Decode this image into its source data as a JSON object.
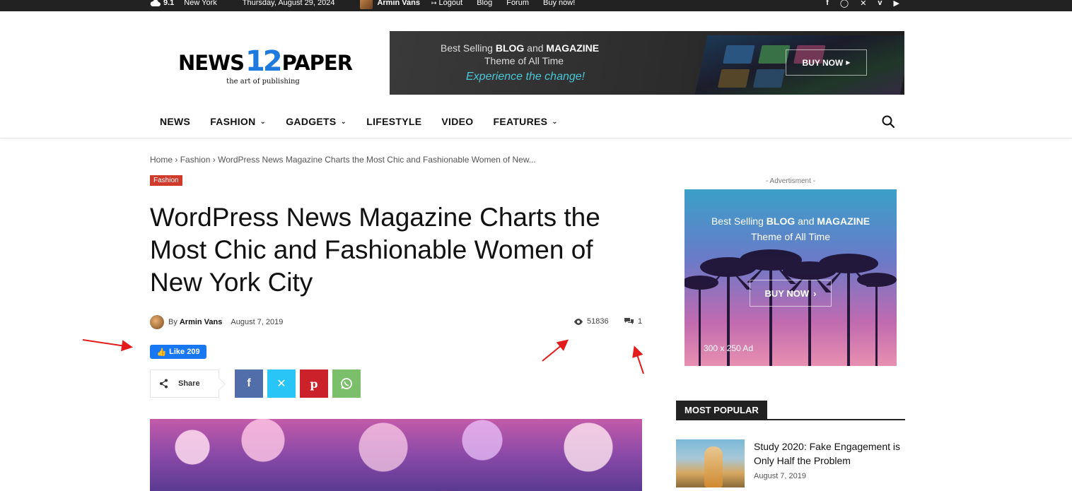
{
  "topbar": {
    "temperature": "9.1",
    "city": "New York",
    "date": "Thursday, August 29, 2024",
    "user_name": "Armin Vans",
    "logout_label": "Logout",
    "links": [
      "Blog",
      "Forum",
      "Buy now!"
    ],
    "social_icons": [
      "facebook-icon",
      "instagram-icon",
      "x-icon",
      "vimeo-icon",
      "youtube-icon"
    ]
  },
  "logo": {
    "part1": "NEWS",
    "number": "12",
    "part2": "PAPER",
    "tagline": "the art of publishing"
  },
  "header_banner": {
    "line1_prefix": "Best Selling ",
    "line1_blog": "BLOG",
    "line1_and": " and ",
    "line1_magazine": "MAGAZINE",
    "line2": "Theme of All Time",
    "line3": "Experience the change!",
    "button": "BUY NOW"
  },
  "nav": {
    "items": [
      {
        "label": "NEWS",
        "dropdown": false
      },
      {
        "label": "FASHION",
        "dropdown": true
      },
      {
        "label": "GADGETS",
        "dropdown": true
      },
      {
        "label": "LIFESTYLE",
        "dropdown": false
      },
      {
        "label": "VIDEO",
        "dropdown": false
      },
      {
        "label": "FEATURES",
        "dropdown": true
      }
    ]
  },
  "breadcrumb": {
    "home": "Home",
    "category": "Fashion",
    "current": "WordPress News Magazine Charts the Most Chic and Fashionable Women of New..."
  },
  "article": {
    "category": "Fashion",
    "title": "WordPress News Magazine Charts the Most Chic and Fashionable Women of New York City",
    "by": "By",
    "author": "Armin Vans",
    "date": "August 7, 2019",
    "views": "51836",
    "comments": "1",
    "like_label": "Like 209",
    "share_label": "Share"
  },
  "sidebar": {
    "ad_label": "- Advertisment -",
    "ad_line1_prefix": "Best Selling ",
    "ad_line1_blog": "BLOG",
    "ad_line1_and": " and ",
    "ad_line1_magazine": "MAGAZINE",
    "ad_line2": "Theme of All Time",
    "ad_button": "BUY NOW",
    "ad_size": "300 x 250 Ad",
    "popular_heading": "MOST POPULAR",
    "popular_items": [
      {
        "title": "Study 2020: Fake Engagement is Only Half the Problem",
        "date": "August 7, 2019"
      }
    ]
  },
  "colors": {
    "topbar_bg": "#222222",
    "category_badge": "#d03a2b",
    "facebook": "#516eab",
    "twitter_x": "#29c5f6",
    "pinterest": "#ca212a",
    "whatsapp": "#7bbf6a",
    "like_button": "#1877f2",
    "annotation_arrow": "#e31b1b"
  }
}
